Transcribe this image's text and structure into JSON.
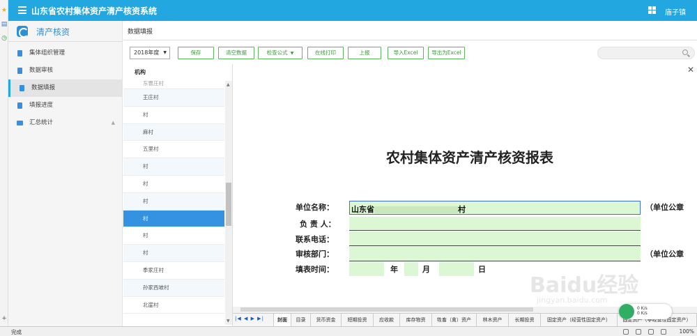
{
  "app": {
    "title": "山东省农村集体资产清产核资系统",
    "user": "庙子镇",
    "module": "清产核资"
  },
  "sidebar": {
    "items": [
      {
        "label": "集体组织管理"
      },
      {
        "label": "数据审核"
      },
      {
        "label": "数据填报"
      },
      {
        "label": "填报进度"
      },
      {
        "label": "汇总统计"
      }
    ]
  },
  "breadcrumb": "数据填报",
  "toolbar": {
    "year": "2018年度",
    "buttons": {
      "save": "保存",
      "clear": "清空数据",
      "check": "检查公式",
      "print": "在线打印",
      "submit": "上报",
      "import": "导入Excel",
      "export": "导出为Excel"
    }
  },
  "org": {
    "header": "机构",
    "rows": [
      "东曹庄村",
      "王庄村",
      "村",
      "麻村",
      "五里村",
      "村",
      "村",
      "村",
      "村",
      "村",
      "村",
      "季家庄村",
      "孙家西坡村",
      "北崖村"
    ]
  },
  "report": {
    "title": "农村集体资产清产核资报表",
    "labels": {
      "unit_name": "单位名称：",
      "owner": "负 责 人：",
      "phone": "联系电话：",
      "audit_dept": "审核部门：",
      "fill_time": "填表时间："
    },
    "values": {
      "unit_name": "山东省",
      "unit_name_end": "村"
    },
    "seal1": "（单位公章",
    "seal2": "（单位公章",
    "date": {
      "year": "年",
      "month": "月",
      "day": "日"
    }
  },
  "sheet_tabs": [
    "封面",
    "目录",
    "货币资金",
    "短期投资",
    "应收款",
    "库存物资",
    "牲畜（禽）资产",
    "林木资产",
    "长期投资",
    "固定资产（经营性固定资产）",
    "固定资产（非经营性固定资产）"
  ],
  "status": {
    "left": "完成",
    "zoom": "100%"
  },
  "watermark": {
    "text": "Baidu经验",
    "url": "jingyan.baidu.com"
  },
  "widget": {
    "line1": "0 K/s",
    "line2": "0 K/s"
  },
  "colors": {
    "topbar": "#23a7e0",
    "selected_row": "#3592e0",
    "button_border": "#5cb85c",
    "input_fill": "#dcf7d3"
  }
}
